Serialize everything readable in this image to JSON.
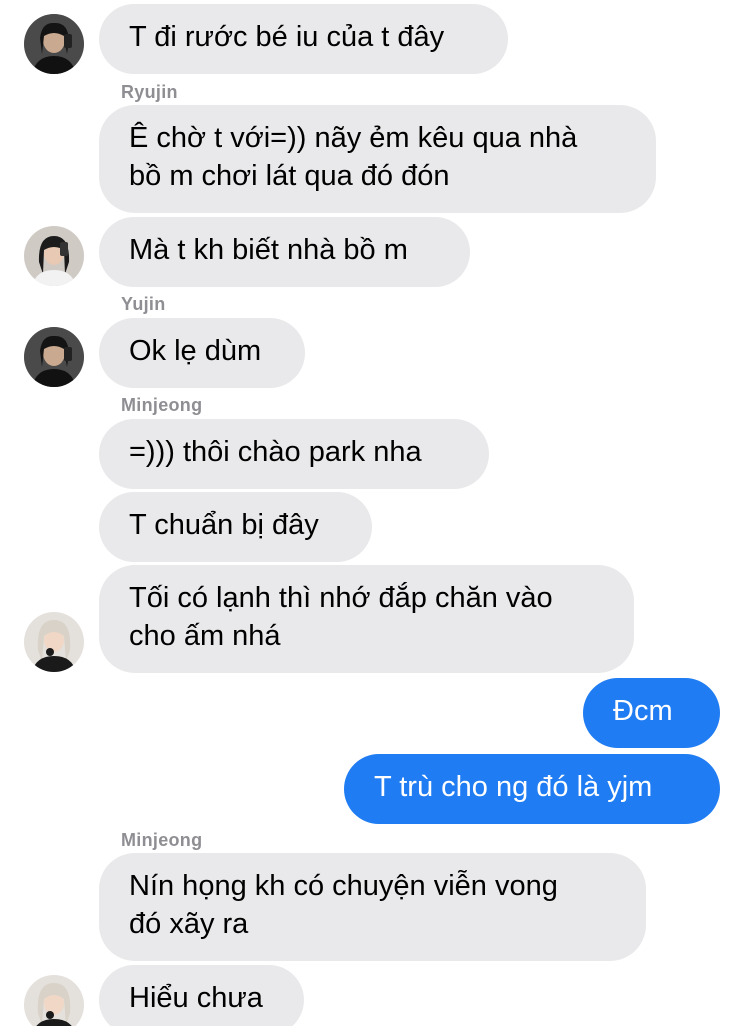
{
  "chat": {
    "messages": [
      {
        "direction": "in",
        "text": "T đi rước bé iu của t đây",
        "avatar": "dark-hair-avatar"
      },
      {
        "direction": "in",
        "sender": "Ryujin",
        "text": "Ê chờ t với=)) nãy ẻm kêu qua nhà\nbồ m chơi lát qua đó đón"
      },
      {
        "direction": "in",
        "text": "Mà t kh biết nhà bồ m",
        "avatar": "long-hair-avatar"
      },
      {
        "direction": "in",
        "sender": "Yujin",
        "text": "Ok lẹ dùm",
        "avatar": "dark-hair-avatar"
      },
      {
        "direction": "in",
        "sender": "Minjeong",
        "text": "=))) thôi chào park nha"
      },
      {
        "direction": "in",
        "text": "T chuẩn bị đây"
      },
      {
        "direction": "in",
        "text": "Tối có lạnh thì nhớ đắp chăn vào\ncho ấm nhá",
        "avatar": "blonde-hair-avatar"
      },
      {
        "direction": "out",
        "text": "Đcm"
      },
      {
        "direction": "out",
        "text": "T trù cho ng đó là yjm"
      },
      {
        "direction": "in",
        "sender": "Minjeong",
        "text": "Nín họng kh có chuyện viễn vong\nđó xãy ra"
      },
      {
        "direction": "in",
        "text": "Hiểu chưa",
        "avatar": "blonde-hair-avatar"
      }
    ]
  },
  "colors": {
    "incoming_bubble": "#e9e9eb",
    "outgoing_bubble": "#1f7cf2",
    "sender_name": "#8e8e93"
  }
}
